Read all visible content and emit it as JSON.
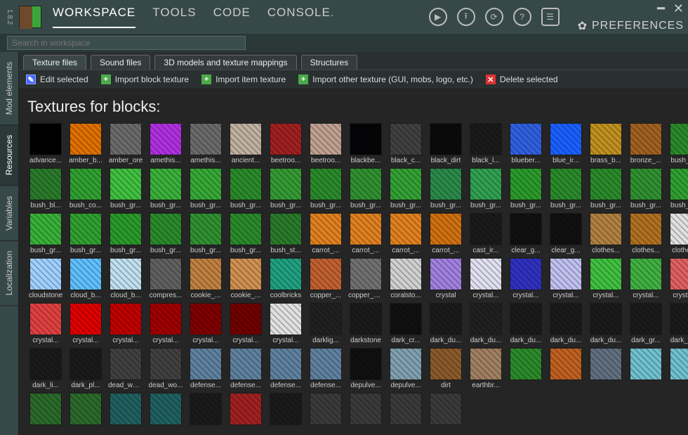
{
  "version": "1.8.2",
  "menu": {
    "workspace": "WORKSPACE",
    "tools": "TOOLS",
    "code": "CODE",
    "console": "CONSOLE"
  },
  "preferences": "PREFERENCES",
  "search_placeholder": "Search in workspace",
  "side_tabs": {
    "mod_elements": "Mod elements",
    "resources": "Resources",
    "variables": "Variables",
    "localization": "Localization"
  },
  "sub_tabs": {
    "texture_files": "Texture files",
    "sound_files": "Sound files",
    "models": "3D models and texture mappings",
    "structures": "Structures"
  },
  "toolbar": {
    "edit_selected": "Edit selected",
    "import_block": "Import block texture",
    "import_item": "Import item texture",
    "import_other": "Import other texture (GUI, mobs, logo, etc.)",
    "delete_selected": "Delete selected"
  },
  "heading": "Textures for blocks:",
  "textures": [
    {
      "label": "advance...",
      "c": "#000000"
    },
    {
      "label": "amber_b...",
      "c": "#e07000"
    },
    {
      "label": "amber_ore",
      "c": "#6a6a6a"
    },
    {
      "label": "amethis...",
      "c": "#b030e0"
    },
    {
      "label": "amethis...",
      "c": "#6a6a6a"
    },
    {
      "label": "ancient...",
      "c": "#c0b0a0"
    },
    {
      "label": "beetroo...",
      "c": "#a02020"
    },
    {
      "label": "beetroo...",
      "c": "#c0a090"
    },
    {
      "label": "blackbe...",
      "c": "#050508"
    },
    {
      "label": "black_c...",
      "c": "#404040"
    },
    {
      "label": "black_dirt",
      "c": "#0a0a0a"
    },
    {
      "label": "black_l...",
      "c": "#1a1a1a"
    },
    {
      "label": "blueber...",
      "c": "#3060e0"
    },
    {
      "label": "blue_ir...",
      "c": "#1a60ff"
    },
    {
      "label": "brass_b...",
      "c": "#c09020"
    },
    {
      "label": "bronze_...",
      "c": "#a06020"
    },
    {
      "label": "bush_bl...",
      "c": "#2a8a2a"
    },
    {
      "label": "bush_bl...",
      "c": "#2a7a2a"
    },
    {
      "label": "bush_co...",
      "c": "#30a030"
    },
    {
      "label": "bush_gr...",
      "c": "#40c040"
    },
    {
      "label": "bush_gr...",
      "c": "#3ab03a"
    },
    {
      "label": "bush_gr...",
      "c": "#36a836"
    },
    {
      "label": "bush_gr...",
      "c": "#2a8a2a"
    },
    {
      "label": "bush_gr...",
      "c": "#349a34"
    },
    {
      "label": "bush_gr...",
      "c": "#2a8a2a"
    },
    {
      "label": "bush_gr...",
      "c": "#309030"
    },
    {
      "label": "bush_gr...",
      "c": "#34a034"
    },
    {
      "label": "bush_gr...",
      "c": "#2a8a4a"
    },
    {
      "label": "bush_gr...",
      "c": "#30a050"
    },
    {
      "label": "bush_gr...",
      "c": "#2a9a2a"
    },
    {
      "label": "bush_gr...",
      "c": "#2a8a2a"
    },
    {
      "label": "bush_gr...",
      "c": "#2a8a2a"
    },
    {
      "label": "bush_gr...",
      "c": "#309030"
    },
    {
      "label": "bush_gr...",
      "c": "#30a030"
    },
    {
      "label": "bush_gr...",
      "c": "#38b038"
    },
    {
      "label": "bush_gr...",
      "c": "#30a030"
    },
    {
      "label": "bush_gr...",
      "c": "#2a9a2a"
    },
    {
      "label": "bush_gr...",
      "c": "#2a8a2a"
    },
    {
      "label": "bush_gr...",
      "c": "#309030"
    },
    {
      "label": "bush_gr...",
      "c": "#2a8a2a"
    },
    {
      "label": "bush_st...",
      "c": "#2a7a2a"
    },
    {
      "label": "carrot_...",
      "c": "#e08020"
    },
    {
      "label": "carrot_...",
      "c": "#e08020"
    },
    {
      "label": "carrot_...",
      "c": "#e08020"
    },
    {
      "label": "carrot_...",
      "c": "#d07010"
    },
    {
      "label": "cast_ir...",
      "c": "#1a1a1a"
    },
    {
      "label": "clear_g...",
      "c": "#101010"
    },
    {
      "label": "clear_g...",
      "c": "#101010"
    },
    {
      "label": "clothes...",
      "c": "#b08040"
    },
    {
      "label": "clothes...",
      "c": "#b07020"
    },
    {
      "label": "clothes...",
      "c": "#e0e0e0"
    },
    {
      "label": "cloudstone",
      "c": "#a0d0ff"
    },
    {
      "label": "cloud_b...",
      "c": "#60c0ff"
    },
    {
      "label": "cloud_b...",
      "c": "#c0e0f0"
    },
    {
      "label": "compres...",
      "c": "#606060"
    },
    {
      "label": "cookie_...",
      "c": "#c08040"
    },
    {
      "label": "cookie_...",
      "c": "#d09050"
    },
    {
      "label": "coolbricks",
      "c": "#20a080"
    },
    {
      "label": "copper_...",
      "c": "#c06030"
    },
    {
      "label": "copper_ore",
      "c": "#707070"
    },
    {
      "label": "coralsto...",
      "c": "#d0d0d0"
    },
    {
      "label": "crystal",
      "c": "#a080e0"
    },
    {
      "label": "crystal...",
      "c": "#e0e0f0"
    },
    {
      "label": "crystal...",
      "c": "#3030c0"
    },
    {
      "label": "crystal...",
      "c": "#c0c0f0"
    },
    {
      "label": "crystal...",
      "c": "#40c040"
    },
    {
      "label": "crystal...",
      "c": "#40b040"
    },
    {
      "label": "crystal...",
      "c": "#e06060"
    },
    {
      "label": "crystal...",
      "c": "#e04040"
    },
    {
      "label": "crystal...",
      "c": "#e00000"
    },
    {
      "label": "crystal...",
      "c": "#c00000"
    },
    {
      "label": "crystal...",
      "c": "#a00000"
    },
    {
      "label": "crystal...",
      "c": "#800000"
    },
    {
      "label": "crystal...",
      "c": "#700000"
    },
    {
      "label": "crystal...",
      "c": "#e0e0e0"
    },
    {
      "label": "darklig...",
      "c": "#202020"
    },
    {
      "label": "darkstone",
      "c": "#1a1a1a"
    },
    {
      "label": "dark_cr...",
      "c": "#101010"
    },
    {
      "label": "dark_du...",
      "c": "#1a1a1a"
    },
    {
      "label": "dark_du...",
      "c": "#202020"
    },
    {
      "label": "dark_du...",
      "c": "#1a1a1a"
    },
    {
      "label": "dark_du...",
      "c": "#1a1a1a"
    },
    {
      "label": "dark_du...",
      "c": "#1a1a1a"
    },
    {
      "label": "dark_gr...",
      "c": "#1a1a1a"
    },
    {
      "label": "dark_ho...",
      "c": "#1a1a1a"
    },
    {
      "label": "dark_li...",
      "c": "#1a1a1a"
    },
    {
      "label": "dark_pl...",
      "c": "#1a1a1a"
    },
    {
      "label": "dead_wood",
      "c": "#404040"
    },
    {
      "label": "dead_wo...",
      "c": "#404040"
    },
    {
      "label": "defense...",
      "c": "#6080a0"
    },
    {
      "label": "defense...",
      "c": "#6080a0"
    },
    {
      "label": "defense...",
      "c": "#6080a0"
    },
    {
      "label": "defense...",
      "c": "#6080a0"
    },
    {
      "label": "depulve...",
      "c": "#101010"
    },
    {
      "label": "depulve...",
      "c": "#80a0b0"
    },
    {
      "label": "dirt",
      "c": "#8a5a2a"
    },
    {
      "label": "earthbr...",
      "c": "#a08060"
    },
    {
      "label": "",
      "c": "#2a8a2a"
    },
    {
      "label": "",
      "c": "#c06020"
    },
    {
      "label": "",
      "c": "#607080"
    },
    {
      "label": "",
      "c": "#70c0d0"
    },
    {
      "label": "",
      "c": "#70c0d0"
    },
    {
      "label": "",
      "c": "#2a6a2a"
    },
    {
      "label": "",
      "c": "#2a6a2a"
    },
    {
      "label": "",
      "c": "#206060"
    },
    {
      "label": "",
      "c": "#206060"
    },
    {
      "label": "",
      "c": "#1a1a1a"
    },
    {
      "label": "",
      "c": "#a02020"
    },
    {
      "label": "",
      "c": "#1a1a1a"
    },
    {
      "label": "",
      "c": "#3a3a3a"
    },
    {
      "label": "",
      "c": "#3a3a3a"
    },
    {
      "label": "",
      "c": "#3a3a3a"
    },
    {
      "label": "",
      "c": "#3a3a3a"
    }
  ]
}
